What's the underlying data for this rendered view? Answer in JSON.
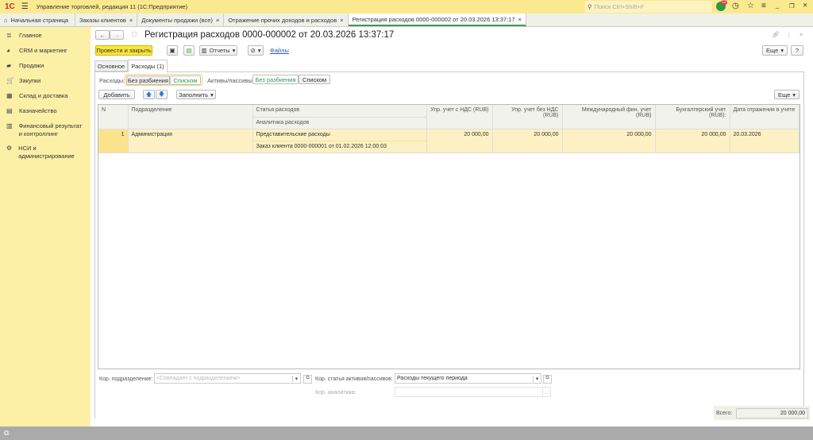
{
  "app": {
    "logo": "1С",
    "title": "Управление торговлей, редакция 11  (1С:Предприятие)",
    "search_placeholder": "Поиск Ctrl+Shift+F",
    "notifications": "12"
  },
  "tabs": [
    {
      "label": "Начальная страница"
    },
    {
      "label": "Заказы клиентов"
    },
    {
      "label": "Документы продажи (все)"
    },
    {
      "label": "Отражение прочих доходов и расходов"
    },
    {
      "label": "Регистрация расходов 0000-000002 от 20.03.2026 13:37:17"
    }
  ],
  "sidebar": {
    "items": [
      {
        "label": "Главное",
        "icon": "≣"
      },
      {
        "label": "CRM и маркетинг",
        "icon": "◕"
      },
      {
        "label": "Продажи",
        "icon": "▰"
      },
      {
        "label": "Закупки",
        "icon": "🛒"
      },
      {
        "label": "Склад и доставка",
        "icon": "▦"
      },
      {
        "label": "Казначейство",
        "icon": "▤"
      },
      {
        "label": "Финансовый результат и контроллинг",
        "icon": "▥"
      },
      {
        "label": "НСИ и администрирование",
        "icon": "⚙"
      }
    ]
  },
  "form": {
    "title": "Регистрация расходов 0000-000002 от 20.03.2026 13:37:17",
    "post_close": "Провести и закрыть",
    "reports": "Отчеты",
    "files": "Файлы",
    "more": "Еще",
    "help": "?",
    "subtabs": [
      "Основное",
      "Расходы (1)"
    ],
    "expenses_label": "Расходы:",
    "assets_label": "Активы/пассивы:",
    "no_split": "Без разбиения",
    "list": "Списком",
    "add": "Добавить",
    "fill": "Заполнить",
    "more2": "Еще"
  },
  "table": {
    "headers": {
      "n": "N",
      "dept": "Подразделение",
      "article": "Статья расходов",
      "analytics": "Аналитика расходов",
      "vat": "Упр. учет с НДС (RUB)",
      "novat": "Упр. учет без НДС (RUB)",
      "intl": "Международный фин. учет (RUB)",
      "acc": "Бухгалтерский учет (RUB):",
      "date": "Дата отражения в учете"
    },
    "rows": [
      {
        "n": "1",
        "dept": "Администрация",
        "article": "Представительские расходы",
        "analytics": "Заказ клиента 0000-000001 от 01.02.2026 12:00:03",
        "vat": "20 000,00",
        "novat": "20 000,00",
        "intl": "20 000,00",
        "acc": "20 000,00",
        "date": "20.03.2026"
      }
    ]
  },
  "bottom": {
    "kor_dept_label": "Кор. подразделение:",
    "kor_dept_placeholder": "<Совпадает с подразделением>",
    "kor_article_label": "Кор. статья активов/пассивов:",
    "kor_article_value": "Расходы текущего периода",
    "kor_analytics_label": "Кор. аналитика:",
    "total_label": "Всего:",
    "total_value": "20 000,00"
  }
}
